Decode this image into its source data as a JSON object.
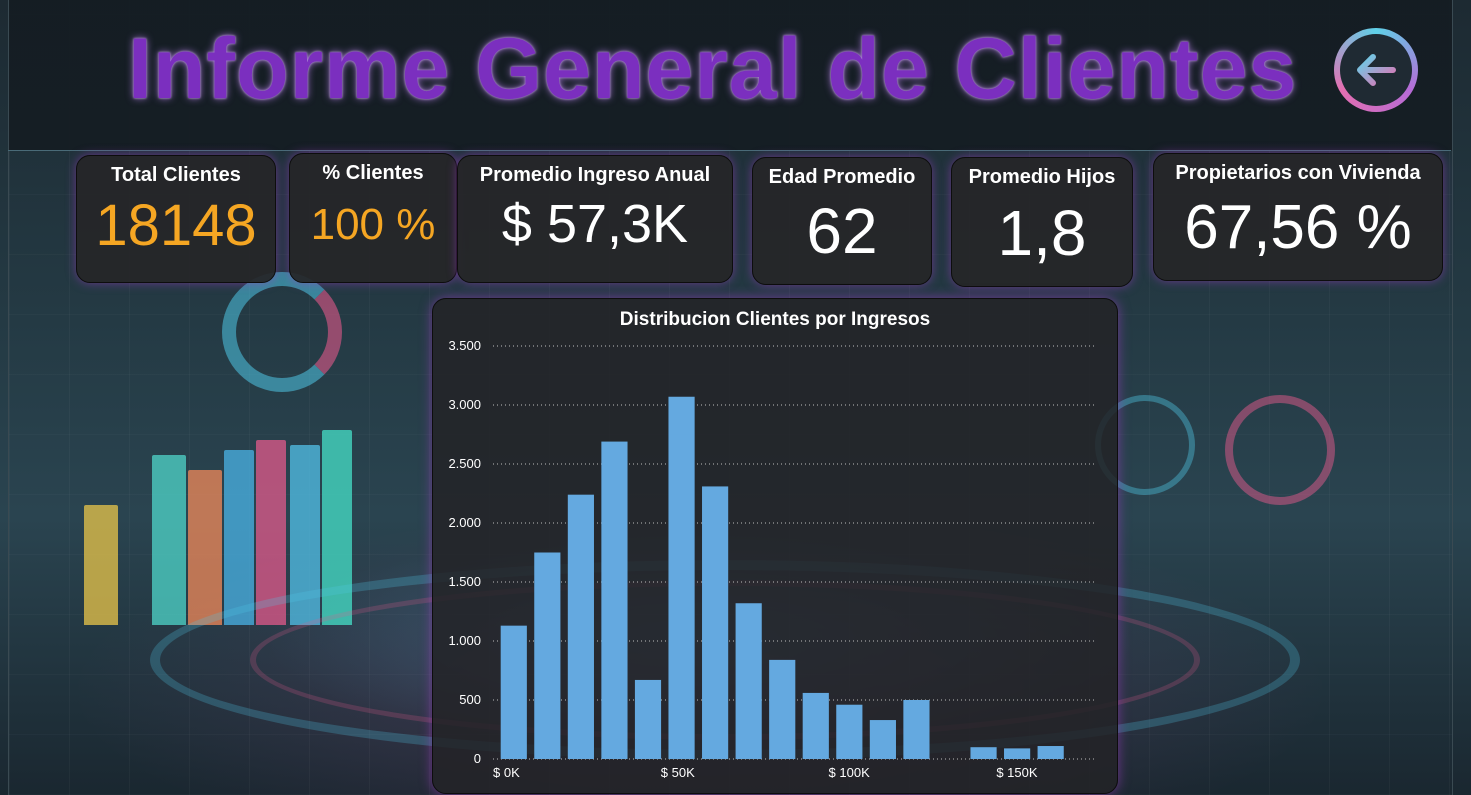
{
  "header": {
    "title": "Informe General de Clientes"
  },
  "kpis": [
    {
      "label": "Total Clientes",
      "value": "18148"
    },
    {
      "label": "% Clientes",
      "value": "100 %"
    },
    {
      "label": "Promedio Ingreso Anual",
      "value": "$ 57,3K"
    },
    {
      "label": "Edad Promedio",
      "value": "62"
    },
    {
      "label": "Promedio Hijos",
      "value": "1,8"
    },
    {
      "label": "Propietarios con Vivienda",
      "value": "67,56 %"
    }
  ],
  "icons": {
    "back": "arrow-left-circle-icon"
  },
  "colors": {
    "title": "#7b2fbf",
    "accent_orange": "#f5a623",
    "bar": "#64a9e0"
  },
  "chart_data": {
    "type": "bar",
    "title": "Distribucion Clientes por Ingresos",
    "x": [
      10000,
      20000,
      30000,
      40000,
      50000,
      60000,
      70000,
      80000,
      90000,
      100000,
      110000,
      120000,
      130000,
      140000,
      160000,
      170000,
      180000
    ],
    "values": [
      1130,
      1750,
      2240,
      2690,
      670,
      3070,
      2310,
      1320,
      840,
      560,
      460,
      330,
      500,
      100,
      90,
      110
    ],
    "bar_x": [
      10000,
      20000,
      30000,
      40000,
      50000,
      60000,
      70000,
      80000,
      90000,
      100000,
      110000,
      120000,
      130000,
      150000,
      160000,
      170000
    ],
    "xlim": [
      0,
      180000
    ],
    "ylim": [
      0,
      3500
    ],
    "yticks": [
      "0",
      "500",
      "1.000",
      "1.500",
      "2.000",
      "2.500",
      "3.000",
      "3.500"
    ],
    "xticks": [
      {
        "x": 0,
        "label": "$ 0K"
      },
      {
        "x": 50000,
        "label": "$ 50K"
      },
      {
        "x": 100000,
        "label": "$ 100K"
      },
      {
        "x": 150000,
        "label": "$ 150K"
      }
    ],
    "grid": true
  }
}
